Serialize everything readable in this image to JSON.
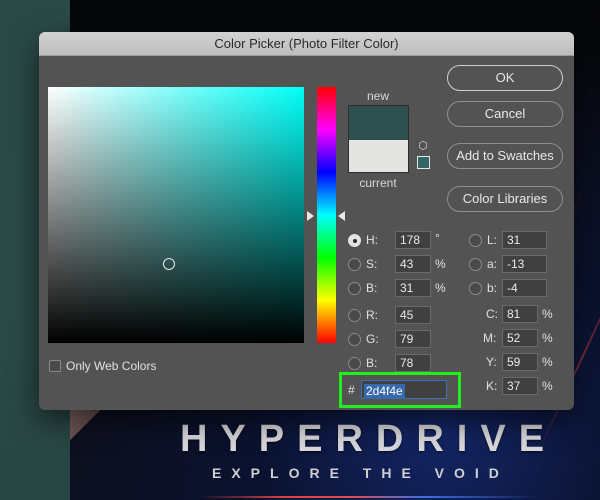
{
  "dialog": {
    "title": "Color Picker (Photo Filter Color)"
  },
  "buttons": {
    "ok": "OK",
    "cancel": "Cancel",
    "add_to_swatches": "Add to Swatches",
    "color_libraries": "Color Libraries"
  },
  "preview": {
    "new_label": "new",
    "current_label": "current",
    "new_color": "#2d4f4e",
    "current_color": "#e4e5e2",
    "cube_icon": "3d-cube-icon",
    "websafe_swatch_icon": "web-safe-swatch-icon"
  },
  "hsb": [
    {
      "label": "H:",
      "value": "178",
      "unit": "°",
      "selected": true
    },
    {
      "label": "S:",
      "value": "43",
      "unit": "%",
      "selected": false
    },
    {
      "label": "B:",
      "value": "31",
      "unit": "%",
      "selected": false
    }
  ],
  "rgb": [
    {
      "label": "R:",
      "value": "45",
      "selected": false
    },
    {
      "label": "G:",
      "value": "79",
      "selected": false
    },
    {
      "label": "B:",
      "value": "78",
      "selected": false
    }
  ],
  "lab": [
    {
      "label": "L:",
      "value": "31",
      "selected": false
    },
    {
      "label": "a:",
      "value": "-13",
      "selected": false
    },
    {
      "label": "b:",
      "value": "-4",
      "selected": false
    }
  ],
  "cmyk": [
    {
      "label": "C:",
      "value": "81",
      "unit": "%"
    },
    {
      "label": "M:",
      "value": "52",
      "unit": "%"
    },
    {
      "label": "Y:",
      "value": "59",
      "unit": "%"
    },
    {
      "label": "K:",
      "value": "37",
      "unit": "%"
    }
  ],
  "hex": {
    "hash": "#",
    "value": "2d4f4e"
  },
  "options": {
    "only_web_colors_label": "Only Web Colors",
    "only_web_colors_checked": false
  },
  "background": {
    "poster_title": "HYPERDRIVE",
    "poster_subtitle": "EXPLORE THE VOID"
  },
  "colors": {
    "hue_base": "#00fff8",
    "highlight": "#22ee22",
    "dialog_bg": "#535353"
  }
}
